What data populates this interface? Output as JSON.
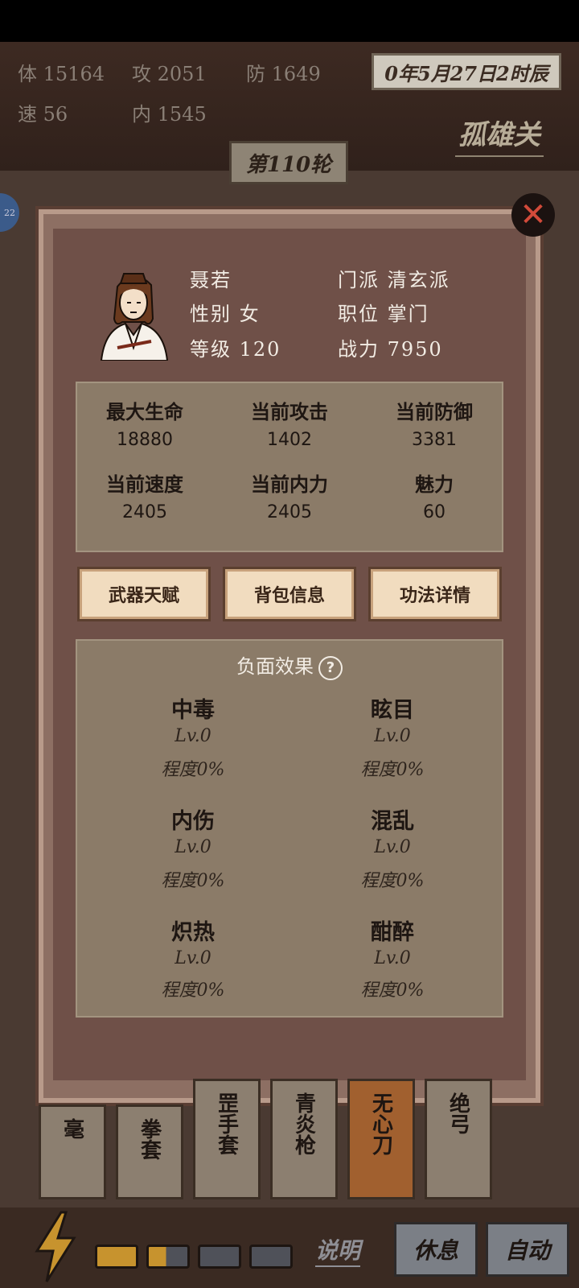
{
  "header": {
    "stats": [
      {
        "label": "体",
        "value": "15164"
      },
      {
        "label": "攻",
        "value": "2051"
      },
      {
        "label": "防",
        "value": "1649"
      },
      {
        "label": "速",
        "value": "56"
      },
      {
        "label": "内",
        "value": "1545"
      }
    ],
    "date": "0年5月27日2时辰",
    "location": "孤雄关",
    "round": "第110轮",
    "side_badge": "22"
  },
  "character": {
    "name": "聂若",
    "gender": "性别 女",
    "level": "等级 120",
    "sect": "门派 清玄派",
    "position": "职位 掌门",
    "power": "战力 7950"
  },
  "attributes": [
    {
      "label": "最大生命",
      "value": "18880"
    },
    {
      "label": "当前攻击",
      "value": "1402"
    },
    {
      "label": "当前防御",
      "value": "3381"
    },
    {
      "label": "当前速度",
      "value": "2405"
    },
    {
      "label": "当前内力",
      "value": "2405"
    },
    {
      "label": "魅力",
      "value": "60"
    }
  ],
  "buttons": [
    "武器天赋",
    "背包信息",
    "功法详情"
  ],
  "debuffs": {
    "title": "负面效果",
    "help": "?",
    "items": [
      {
        "name": "中毒",
        "level": "Lv.0",
        "degree": "程度0%"
      },
      {
        "name": "眩目",
        "level": "Lv.0",
        "degree": "程度0%"
      },
      {
        "name": "内伤",
        "level": "Lv.0",
        "degree": "程度0%"
      },
      {
        "name": "混乱",
        "level": "Lv.0",
        "degree": "程度0%"
      },
      {
        "name": "炽热",
        "level": "Lv.0",
        "degree": "程度0%"
      },
      {
        "name": "酣醉",
        "level": "Lv.0",
        "degree": "程度0%"
      }
    ]
  },
  "cards": [
    "毫",
    "拳套",
    "罡手套",
    "青炎枪",
    "无心刀",
    "绝弓"
  ],
  "bottom": {
    "energy_filled": 1,
    "energy_half": 1,
    "energy_total": 4,
    "explain": "说明",
    "rest": "休息",
    "auto": "自动"
  },
  "colors": {
    "close": "#d24a3a",
    "active_card": "#a1602f",
    "energy": "#c7932e"
  }
}
